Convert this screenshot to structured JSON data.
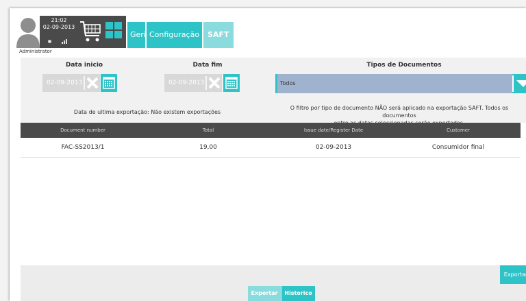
{
  "header": {
    "time": "21:02",
    "date": "02-09-2013",
    "user": "Administrator",
    "nav": [
      "Gerir",
      "Configuração",
      "SAFT"
    ]
  },
  "filters": {
    "start_label": "Data inicio",
    "end_label": "Data fim",
    "doc_types_label": "Tipos de Documentos",
    "start_value": "02-09-2013",
    "end_value": "02-09-2013",
    "doc_type_selected": "Todos",
    "last_export_note": "Data de ultima exportação: Não existem exportações",
    "filter_note_line1": "O filtro por tipo de documento NÃO será aplicado na exportação SAFT. Todos os documentos",
    "filter_note_line2": "entre as datas seleccionadas serão exportados."
  },
  "table": {
    "columns": [
      "Document number",
      "Total",
      "Issue date/Register Date",
      "Customer"
    ],
    "rows": [
      [
        "FAC-SS2013/1",
        "19,00",
        "02-09-2013",
        "Consumidor final"
      ]
    ]
  },
  "actions": {
    "export_right": "Exportar",
    "export_bottom": "Exportar",
    "history": "Historico"
  },
  "colors": {
    "accent": "#2ec4c7",
    "accent_light": "#8adbdd",
    "dark": "#4a4a4a",
    "select_bg": "#9fb3cf"
  }
}
